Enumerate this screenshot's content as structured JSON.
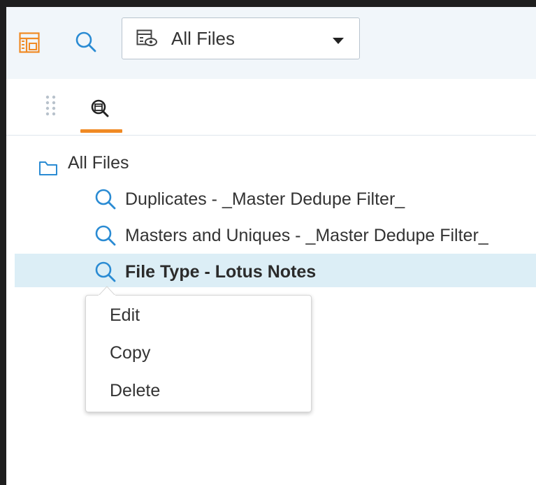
{
  "toolbar": {
    "view_selector": {
      "selected_label": "All Files",
      "icon": "saved-view-icon"
    },
    "icons": [
      "layout-toggle-icon",
      "search-icon"
    ]
  },
  "tabs": [
    {
      "icon": "drag-handle-icon"
    },
    {
      "icon": "saved-search-icon",
      "active": true
    }
  ],
  "tree": {
    "root": {
      "label": "All Files",
      "icon": "folder-icon"
    },
    "items": [
      {
        "label": "Duplicates - _Master Dedupe Filter_",
        "icon": "search-icon",
        "selected": false
      },
      {
        "label": "Masters and Uniques - _Master Dedupe Filter_",
        "icon": "search-icon",
        "selected": false
      },
      {
        "label": "File Type - Lotus Notes",
        "icon": "search-icon",
        "selected": true
      }
    ]
  },
  "context_menu": {
    "items": [
      "Edit",
      "Copy",
      "Delete"
    ]
  },
  "colors": {
    "accent_orange": "#f08a24",
    "accent_blue": "#2a8bd3",
    "selection_bg": "#dceef6",
    "toolbar_bg": "#f1f6fa"
  }
}
